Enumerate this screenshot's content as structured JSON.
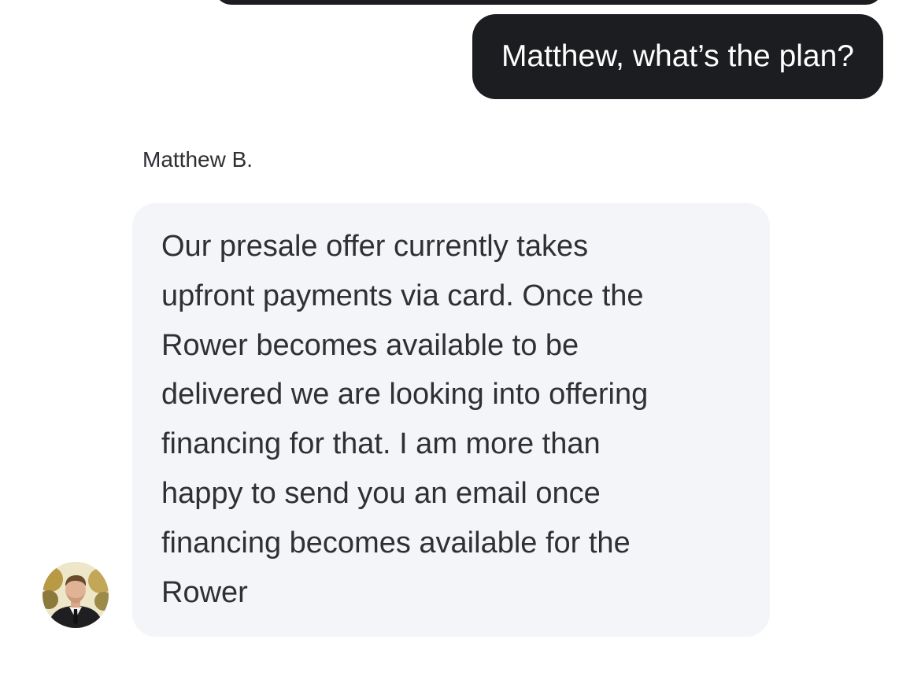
{
  "conversation": {
    "outgoing_message": "Matthew, what’s the plan?",
    "incoming": {
      "sender_name": "Matthew B.",
      "message": "Our presale offer currently takes\nupfront payments via card. Once the\nRower becomes available to be\ndelivered we are looking into offering\nfinancing for that. I am more than\nhappy to send you an email once\nfinancing becomes available for the\nRower"
    }
  },
  "colors": {
    "outgoing_bubble": "#1c1d20",
    "incoming_bubble": "#f3f5f8",
    "text_dark": "#2f3034"
  },
  "icons": {
    "avatar": "user-avatar-photo"
  }
}
